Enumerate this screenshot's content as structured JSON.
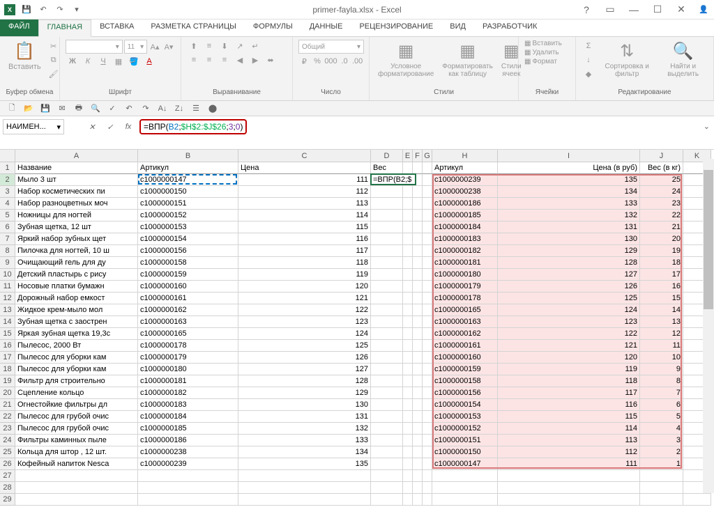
{
  "title": "primer-fayla.xlsx - Excel",
  "tabs": {
    "file": "ФАЙЛ",
    "items": [
      "ГЛАВНАЯ",
      "ВСТАВКА",
      "РАЗМЕТКА СТРАНИЦЫ",
      "ФОРМУЛЫ",
      "ДАННЫЕ",
      "РЕЦЕНЗИРОВАНИЕ",
      "ВИД",
      "РАЗРАБОТЧИК"
    ],
    "active": 0
  },
  "ribbon": {
    "paste": "Вставить",
    "clipboard": "Буфер обмена",
    "font": "Шрифт",
    "font_size": "11",
    "alignment": "Выравнивание",
    "number": "Число",
    "number_format": "Общий",
    "styles": "Стили",
    "cond_format": "Условное форматирование",
    "format_table": "Форматировать как таблицу",
    "cell_styles": "Стили ячеек",
    "cells": "Ячейки",
    "insert": "Вставить",
    "delete": "Удалить",
    "format": "Формат",
    "editing": "Редактирование",
    "sort": "Сортировка и фильтр",
    "find": "Найти и выделить"
  },
  "name_box": "НАИМЕН...",
  "formula": {
    "prefix": "=ВПР(",
    "ref1": "B2",
    "sep1": ";",
    "ref2": "$H$2:$J$26",
    "sep2": ";",
    "num1": "3",
    "sep3": ";",
    "num2": "0",
    "suffix": ")"
  },
  "edit_cell_text": "=ВПР(B2;$",
  "columns": {
    "letters": [
      "A",
      "B",
      "C",
      "D",
      "E",
      "F",
      "G",
      "H",
      "I",
      "J",
      "K"
    ],
    "widths": [
      176,
      144,
      190,
      46,
      14,
      14,
      14,
      94,
      204,
      62,
      40
    ]
  },
  "headers1": {
    "A": "Название",
    "B": "Артикул",
    "C": "Цена",
    "D": "Вес"
  },
  "headers2": {
    "H": "Артикул",
    "I": "Цена (в руб)",
    "J": "Вес (в кг)"
  },
  "rows_left": [
    {
      "n": 2,
      "a": "Мыло 3 шт",
      "b": "c1000000147",
      "c": "111"
    },
    {
      "n": 3,
      "a": "Набор косметических пи",
      "b": "c1000000150",
      "c": "112"
    },
    {
      "n": 4,
      "a": "Набор разноцветных моч",
      "b": "c1000000151",
      "c": "113"
    },
    {
      "n": 5,
      "a": "Ножницы для ногтей",
      "b": "c1000000152",
      "c": "114"
    },
    {
      "n": 6,
      "a": "Зубная щетка, 12 шт",
      "b": "c1000000153",
      "c": "115"
    },
    {
      "n": 7,
      "a": "Яркий набор зубных щет",
      "b": "c1000000154",
      "c": "116"
    },
    {
      "n": 8,
      "a": "Пилочка для ногтей, 10 ш",
      "b": "c1000000156",
      "c": "117"
    },
    {
      "n": 9,
      "a": "Очищающий гель для ду",
      "b": "c1000000158",
      "c": "118"
    },
    {
      "n": 10,
      "a": "Детский пластырь с рису",
      "b": "c1000000159",
      "c": "119"
    },
    {
      "n": 11,
      "a": "Носовые платки бумажн",
      "b": "c1000000160",
      "c": "120"
    },
    {
      "n": 12,
      "a": "Дорожный набор емкост",
      "b": "c1000000161",
      "c": "121"
    },
    {
      "n": 13,
      "a": "Жидкое крем-мыло мол",
      "b": "c1000000162",
      "c": "122"
    },
    {
      "n": 14,
      "a": "Зубная щетка с заострен",
      "b": "c1000000163",
      "c": "123"
    },
    {
      "n": 15,
      "a": "Яркая зубная щетка 19,3с",
      "b": "c1000000165",
      "c": "124"
    },
    {
      "n": 16,
      "a": "Пылесос, 2000 Вт",
      "b": "c1000000178",
      "c": "125"
    },
    {
      "n": 17,
      "a": "Пылесос для уборки кам",
      "b": "c1000000179",
      "c": "126"
    },
    {
      "n": 18,
      "a": "Пылесос для уборки кам",
      "b": "c1000000180",
      "c": "127"
    },
    {
      "n": 19,
      "a": "Фильтр для строительно",
      "b": "c1000000181",
      "c": "128"
    },
    {
      "n": 20,
      "a": "Сцепление кольцо",
      "b": "c1000000182",
      "c": "129"
    },
    {
      "n": 21,
      "a": "Огнестойкие фильтры дл",
      "b": "c1000000183",
      "c": "130"
    },
    {
      "n": 22,
      "a": "Пылесос для грубой очис",
      "b": "c1000000184",
      "c": "131"
    },
    {
      "n": 23,
      "a": "Пылесос для грубой очис",
      "b": "c1000000185",
      "c": "132"
    },
    {
      "n": 24,
      "a": "Фильтры каминных пыле",
      "b": "c1000000186",
      "c": "133"
    },
    {
      "n": 25,
      "a": "Кольца для штор , 12 шт.",
      "b": "c1000000238",
      "c": "134"
    },
    {
      "n": 26,
      "a": "Кофейный напиток Nesca",
      "b": "c1000000239",
      "c": "135"
    }
  ],
  "rows_right": [
    {
      "h": "c1000000239",
      "i": "135",
      "j": "25"
    },
    {
      "h": "c1000000238",
      "i": "134",
      "j": "24"
    },
    {
      "h": "c1000000186",
      "i": "133",
      "j": "23"
    },
    {
      "h": "c1000000185",
      "i": "132",
      "j": "22"
    },
    {
      "h": "c1000000184",
      "i": "131",
      "j": "21"
    },
    {
      "h": "c1000000183",
      "i": "130",
      "j": "20"
    },
    {
      "h": "c1000000182",
      "i": "129",
      "j": "19"
    },
    {
      "h": "c1000000181",
      "i": "128",
      "j": "18"
    },
    {
      "h": "c1000000180",
      "i": "127",
      "j": "17"
    },
    {
      "h": "c1000000179",
      "i": "126",
      "j": "16"
    },
    {
      "h": "c1000000178",
      "i": "125",
      "j": "15"
    },
    {
      "h": "c1000000165",
      "i": "124",
      "j": "14"
    },
    {
      "h": "c1000000163",
      "i": "123",
      "j": "13"
    },
    {
      "h": "c1000000162",
      "i": "122",
      "j": "12"
    },
    {
      "h": "c1000000161",
      "i": "121",
      "j": "11"
    },
    {
      "h": "c1000000160",
      "i": "120",
      "j": "10"
    },
    {
      "h": "c1000000159",
      "i": "119",
      "j": "9"
    },
    {
      "h": "c1000000158",
      "i": "118",
      "j": "8"
    },
    {
      "h": "c1000000156",
      "i": "117",
      "j": "7"
    },
    {
      "h": "c1000000154",
      "i": "116",
      "j": "6"
    },
    {
      "h": "c1000000153",
      "i": "115",
      "j": "5"
    },
    {
      "h": "c1000000152",
      "i": "114",
      "j": "4"
    },
    {
      "h": "c1000000151",
      "i": "113",
      "j": "3"
    },
    {
      "h": "c1000000150",
      "i": "112",
      "j": "2"
    },
    {
      "h": "c1000000147",
      "i": "111",
      "j": "1"
    }
  ]
}
